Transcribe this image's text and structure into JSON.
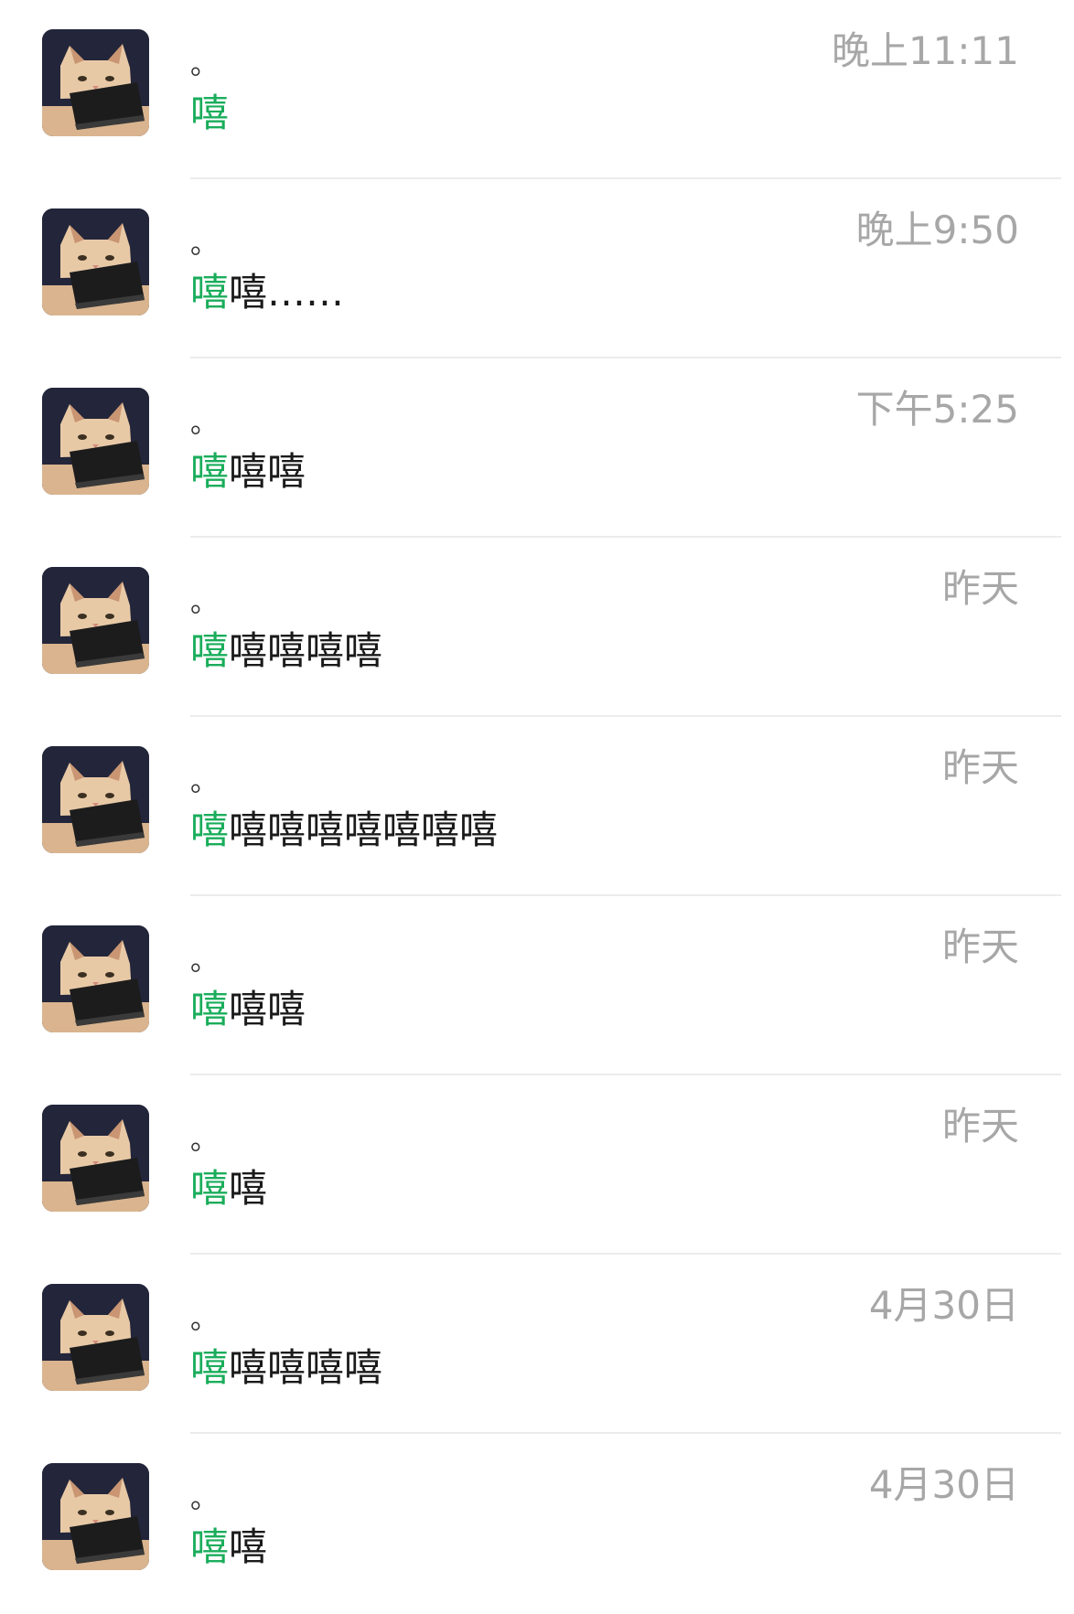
{
  "chats": [
    {
      "name": "。",
      "highlight": "嘻",
      "rest": "",
      "time": "晚上11:11"
    },
    {
      "name": "。",
      "highlight": "嘻",
      "rest": "嘻……",
      "time": "晚上9:50"
    },
    {
      "name": "。",
      "highlight": "嘻",
      "rest": "嘻嘻",
      "time": "下午5:25"
    },
    {
      "name": "。",
      "highlight": "嘻",
      "rest": "嘻嘻嘻嘻",
      "time": "昨天"
    },
    {
      "name": "。",
      "highlight": "嘻",
      "rest": "嘻嘻嘻嘻嘻嘻嘻",
      "time": "昨天"
    },
    {
      "name": "。",
      "highlight": "嘻",
      "rest": "嘻嘻",
      "time": "昨天"
    },
    {
      "name": "。",
      "highlight": "嘻",
      "rest": "嘻",
      "time": "昨天"
    },
    {
      "name": "。",
      "highlight": "嘻",
      "rest": "嘻嘻嘻嘻",
      "time": "4月30日"
    },
    {
      "name": "。",
      "highlight": "嘻",
      "rest": "嘻",
      "time": "4月30日"
    }
  ],
  "colors": {
    "highlight": "#1aad5b",
    "time": "#a7a7a7",
    "divider": "#ececec"
  },
  "icons": {
    "avatar": "cat-with-laptop-avatar-icon"
  }
}
